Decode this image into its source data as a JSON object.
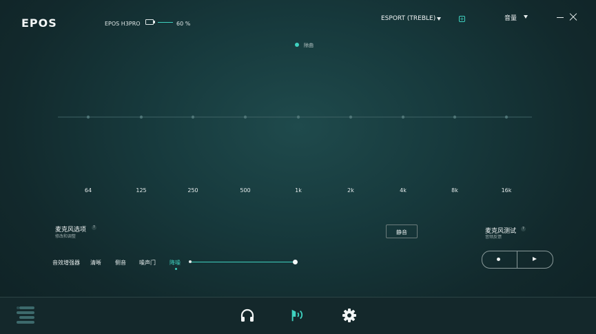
{
  "header": {
    "logo": "EPOS",
    "device_name": "EPOS H3PRO",
    "battery_percent": "60 %",
    "preset_label": "ESPORT (TREBLE)",
    "add_icon": "plus-square-icon",
    "volume_label": "音量"
  },
  "chart_data": {
    "type": "line",
    "series": [
      {
        "name": "除曲",
        "values": [
          0,
          0,
          0,
          0,
          0,
          0,
          0,
          0,
          0
        ]
      }
    ],
    "categories": [
      "64",
      "125",
      "250",
      "500",
      "1k",
      "2k",
      "4k",
      "8k",
      "16k"
    ],
    "legend_position": "top-center",
    "colors": {
      "series": "#3fd2c0",
      "line": "#3e6265"
    }
  },
  "mic": {
    "title": "麦克风选项",
    "subtitle": "修改和调整",
    "mute_label": "静音",
    "tabs": [
      "音效增强器",
      "清晰",
      "侧音",
      "噪声门",
      "降噪"
    ],
    "active_tab": 4,
    "noise_reduction_level": 1.0,
    "test_title": "麦克风测试",
    "test_subtitle": "音频反馈"
  },
  "nav": {
    "items": [
      "headphones-icon",
      "microphone-icon",
      "settings-gear-icon"
    ],
    "active": 1,
    "menu_icon": "menu-drawer-icon"
  },
  "colors": {
    "accent": "#3fd2c0",
    "background": "#173a3d"
  }
}
